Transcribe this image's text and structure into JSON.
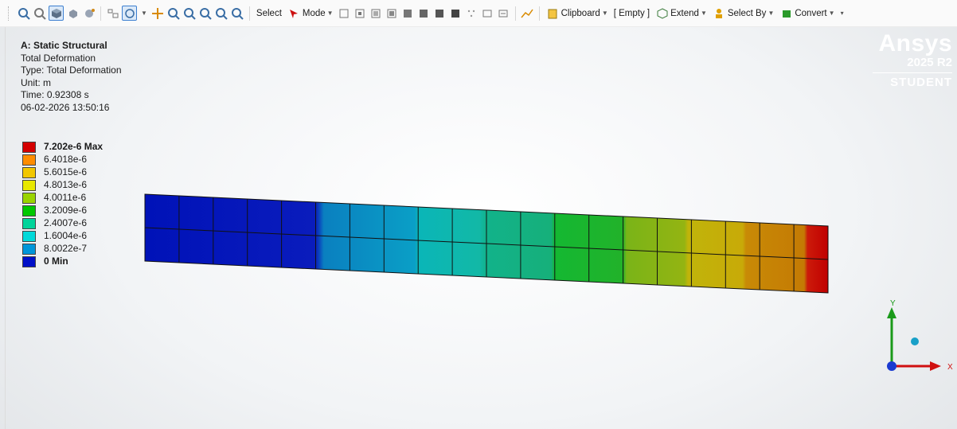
{
  "toolbar": {
    "select_label": "Select",
    "mode_label": "Mode",
    "clipboard_label": "Clipboard",
    "empty_label": "[ Empty ]",
    "extend_label": "Extend",
    "select_by_label": "Select By",
    "convert_label": "Convert"
  },
  "info": {
    "title": "A: Static Structural",
    "result_name": "Total Deformation",
    "type": "Type: Total Deformation",
    "unit": "Unit: m",
    "time": "Time: 0.92308 s",
    "date": "06-02-2026 13:50:16"
  },
  "legend": {
    "max_label": "7.202e-6 Max",
    "min_label": "0 Min",
    "values": [
      "6.4018e-6",
      "5.6015e-6",
      "4.8013e-6",
      "4.0011e-6",
      "3.2009e-6",
      "2.4007e-6",
      "1.6004e-6",
      "8.0022e-7"
    ],
    "colors": [
      "#d40000",
      "#ff8c00",
      "#f2c700",
      "#e8e800",
      "#9ad400",
      "#00c800",
      "#00d49a",
      "#00d9d9",
      "#0096d9",
      "#0010c8"
    ]
  },
  "logo": {
    "brand": "Ansys",
    "version": "2025 R2",
    "edition": "STUDENT"
  },
  "triad": {
    "x_label": "X",
    "y_label": "Y"
  }
}
